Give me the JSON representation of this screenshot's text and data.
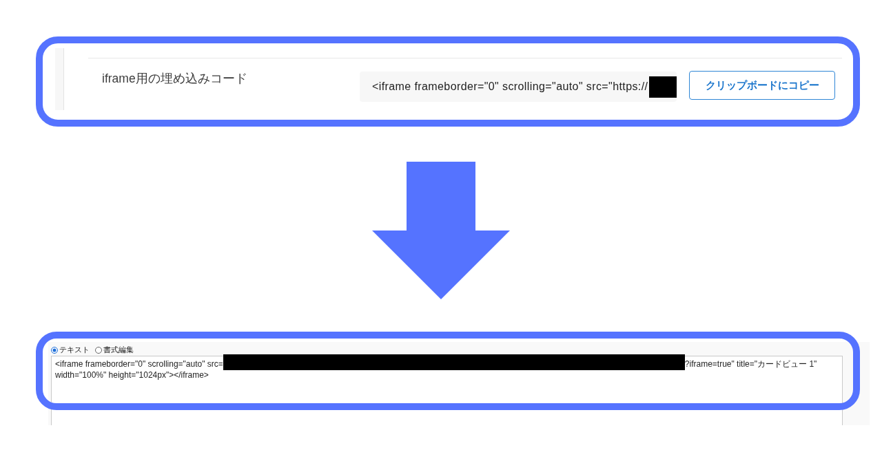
{
  "embed_code_row": {
    "label": "iframe用の埋め込みコード",
    "code": [
      {
        "kind": "text",
        "text": "<iframe frameborder=\"0\" scrolling=\"auto\" src=\"https://"
      },
      {
        "kind": "redacted"
      }
    ],
    "copy_button": "クリップボードにコピー"
  },
  "editor": {
    "modes": [
      {
        "label": "テキスト",
        "selected": true
      },
      {
        "label": "書式編集",
        "selected": false
      }
    ],
    "textarea_lines": [
      [
        {
          "kind": "text",
          "text": "<iframe frameborder=\"0\" scrolling=\"auto\" src="
        },
        {
          "kind": "redacted"
        },
        {
          "kind": "text",
          "text": "?iframe=true\" title=\"カードビュー 1\""
        }
      ],
      [
        {
          "kind": "text",
          "text": "width=\"100%\" height=\"1024px\"></iframe>"
        }
      ]
    ]
  }
}
